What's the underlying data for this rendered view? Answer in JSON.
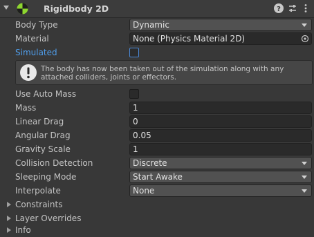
{
  "component": {
    "title": "Rigidbody 2D",
    "icons": [
      "rigidbody2d-icon",
      "help-icon",
      "presets-icon",
      "context-menu-icon"
    ]
  },
  "fields": {
    "body_type": {
      "label": "Body Type",
      "value": "Dynamic"
    },
    "material": {
      "label": "Material",
      "value": "None (Physics Material 2D)"
    },
    "simulated": {
      "label": "Simulated",
      "checked": false
    },
    "help": {
      "text": "The body has now been taken out of the simulation along with any attached colliders, joints or effectors."
    },
    "use_auto_mass": {
      "label": "Use Auto Mass",
      "checked": false
    },
    "mass": {
      "label": "Mass",
      "value": "1"
    },
    "linear_drag": {
      "label": "Linear Drag",
      "value": "0"
    },
    "angular_drag": {
      "label": "Angular Drag",
      "value": "0.05"
    },
    "gravity_scale": {
      "label": "Gravity Scale",
      "value": "1"
    },
    "collision_detection": {
      "label": "Collision Detection",
      "value": "Discrete"
    },
    "sleeping_mode": {
      "label": "Sleeping Mode",
      "value": "Start Awake"
    },
    "interpolate": {
      "label": "Interpolate",
      "value": "None"
    }
  },
  "foldouts": {
    "constraints": "Constraints",
    "layer_overrides": "Layer Overrides",
    "info": "Info"
  },
  "colors": {
    "background": "#383838",
    "accent_blue": "#4f9dea",
    "field_bg": "#2a2a2a",
    "dropdown_bg": "#515151"
  }
}
